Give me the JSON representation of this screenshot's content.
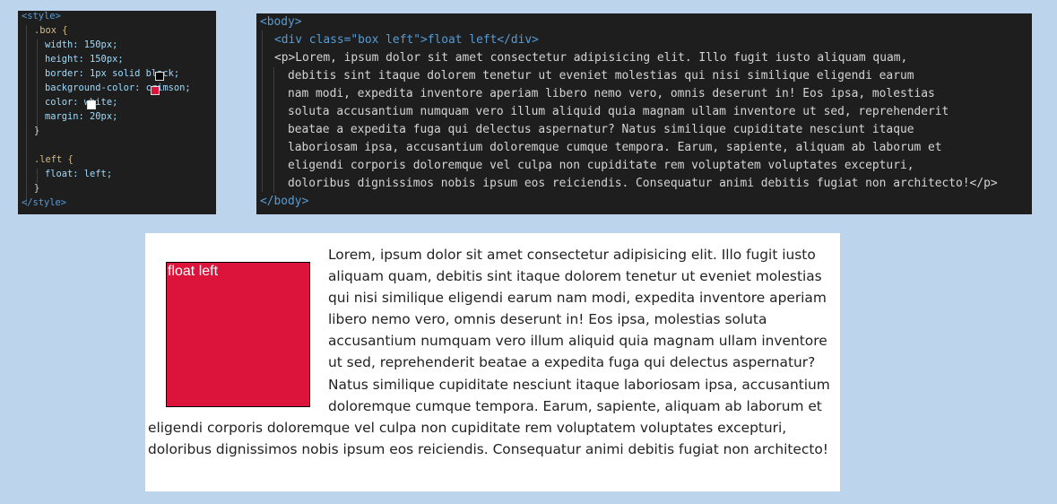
{
  "css_code": {
    "lines": [
      "<style>",
      ".box {",
      "width: 150px;",
      "height: 150px;",
      "border: 1px solid black;",
      "background-color: crimson;",
      "color: white;",
      "margin: 20px;",
      "}",
      "",
      ".left {",
      "float: left;",
      "}",
      "</style>"
    ],
    "swatch_colors": {
      "black": "#000000",
      "crimson": "#dc143c",
      "white": "#ffffff"
    }
  },
  "html_code": {
    "body_open": "<body>",
    "div_line": "<div class=\"box left\">float left</div>",
    "p_lines": [
      "<p>Lorem, ipsum dolor sit amet consectetur adipisicing elit. Illo fugit iusto aliquam quam,",
      "debitis sint itaque dolorem tenetur ut eveniet molestias qui nisi similique eligendi earum",
      "nam modi, expedita inventore aperiam libero nemo vero, omnis deserunt in! Eos ipsa, molestias",
      "soluta accusantium numquam vero illum aliquid quia magnam ullam inventore ut sed, reprehenderit",
      "beatae a expedita fuga qui delectus aspernatur? Natus similique cupiditate nesciunt itaque",
      "laboriosam ipsa, accusantium doloremque cumque tempora. Earum, sapiente, aliquam ab laborum et",
      "eligendi corporis doloremque vel culpa non cupiditate rem voluptatem voluptates excepturi,",
      "doloribus dignissimos nobis ipsum eos reiciendis. Consequatur animi debitis fugiat non architecto!</p>"
    ],
    "body_close": "</body>"
  },
  "result": {
    "box_label": "float left",
    "paragraph": "Lorem, ipsum dolor sit amet consectetur adipisicing elit. Illo fugit iusto aliquam quam, debitis sint itaque dolorem tenetur ut eveniet molestias qui nisi similique eligendi earum nam modi, expedita inventore aperiam libero nemo vero, omnis deserunt in! Eos ipsa, molestias soluta accusantium numquam vero illum aliquid quia magnam ullam inventore ut sed, reprehenderit beatae a expedita fuga qui delectus aspernatur? Natus similique cupiditate nesciunt itaque laboriosam ipsa, accusantium doloremque cumque tempora. Earum, sapiente, aliquam ab laborum et eligendi corporis doloremque vel culpa non cupiditate rem voluptatem voluptates excepturi, doloribus dignissimos nobis ipsum eos reiciendis. Consequatur animi debitis fugiat non architecto!"
  }
}
